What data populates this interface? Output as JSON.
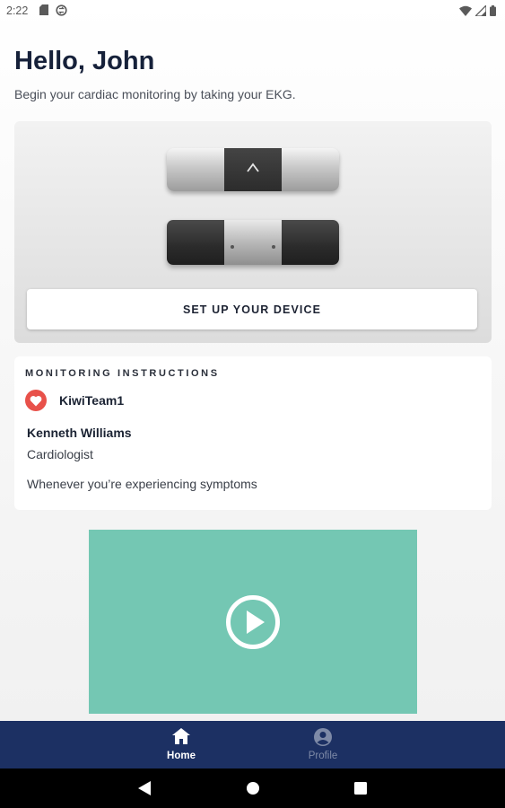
{
  "status_bar": {
    "time": "2:22",
    "left_icons": [
      "sd-card-icon",
      "sync-icon"
    ],
    "right_icons": [
      "wifi-icon",
      "signal-icon",
      "battery-icon"
    ]
  },
  "header": {
    "greeting": "Hello, John",
    "subtitle": "Begin your cardiac monitoring by taking your EKG."
  },
  "device_card": {
    "setup_button_label": "SET UP YOUR DEVICE"
  },
  "instructions": {
    "heading": "MONITORING INSTRUCTIONS",
    "team_name": "KiwiTeam1",
    "doctor_name": "Kenneth Williams",
    "doctor_role": "Cardiologist",
    "instruction_text": "Whenever you’re experiencing symptoms"
  },
  "video": {
    "accent_color": "#74c7b3",
    "icon": "play-icon"
  },
  "bottom_nav": {
    "background_color": "#1c3063",
    "items": [
      {
        "label": "Home",
        "icon": "home-icon",
        "active": true
      },
      {
        "label": "Profile",
        "icon": "profile-icon",
        "active": false
      }
    ]
  },
  "system_nav": {
    "buttons": [
      "back-icon",
      "home-circle-icon",
      "recents-icon"
    ]
  }
}
